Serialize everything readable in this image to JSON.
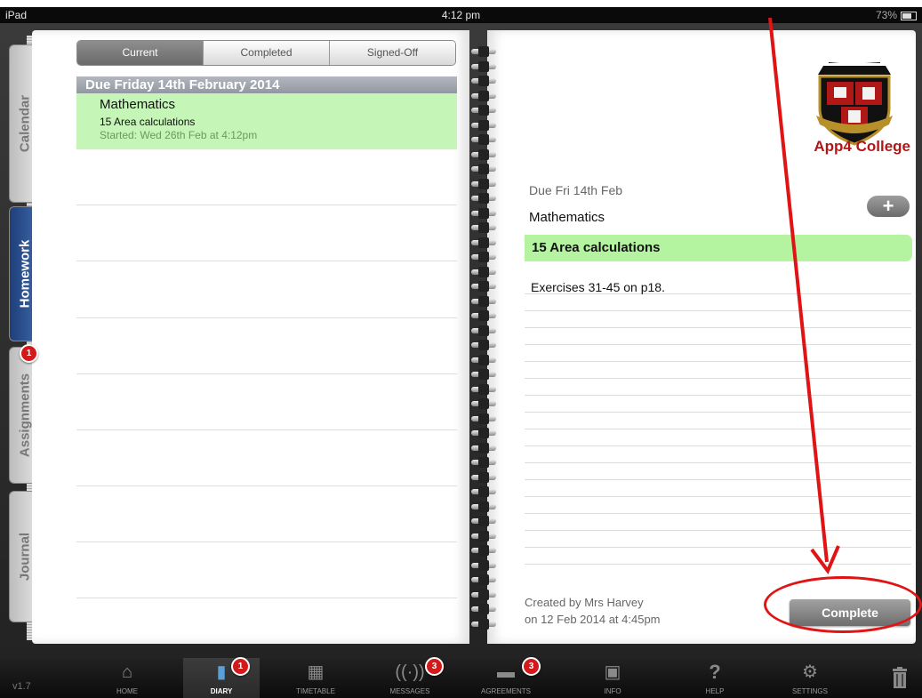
{
  "status_bar": {
    "device": "iPad",
    "time": "4:12 pm",
    "battery": "73%"
  },
  "side_tabs": [
    {
      "label": "Calendar",
      "active": false
    },
    {
      "label": "Homework",
      "active": true
    },
    {
      "label": "Assignments",
      "active": false,
      "badge": "1"
    },
    {
      "label": "Journal",
      "active": false
    }
  ],
  "segments": [
    "Current",
    "Completed",
    "Signed-Off"
  ],
  "selected_segment": "Current",
  "list": {
    "header": "Due Friday 14th February 2014",
    "item": {
      "subject": "Mathematics",
      "title": "15 Area calculations",
      "started": "Started: Wed 26th Feb at 4:12pm"
    }
  },
  "detail": {
    "logo_text": "App4 College",
    "due": "Due Fri 14th Feb",
    "subject": "Mathematics",
    "title": "15 Area calculations",
    "description": "Exercises 31-45 on p18.",
    "created_by": "Created by Mrs Harvey",
    "created_on": "on 12 Feb 2014 at 4:45pm",
    "complete_label": "Complete",
    "add_label": "+"
  },
  "annotation_color": "#e01414",
  "tab_bar": {
    "version": "v1.7",
    "items": [
      {
        "label": "HOME",
        "icon": "home-icon"
      },
      {
        "label": "DIARY",
        "icon": "diary-icon",
        "badge": "1",
        "selected": true
      },
      {
        "label": "TIMETABLE",
        "icon": "timetable-icon"
      },
      {
        "label": "MESSAGES",
        "icon": "messages-icon",
        "badge": "3"
      },
      {
        "label": "AGREEMENTS",
        "icon": "agreements-icon",
        "badge": "3"
      },
      {
        "label": "INFO",
        "icon": "info-icon"
      },
      {
        "label": "HELP",
        "icon": "help-icon"
      },
      {
        "label": "SETTINGS",
        "icon": "settings-icon"
      }
    ]
  }
}
